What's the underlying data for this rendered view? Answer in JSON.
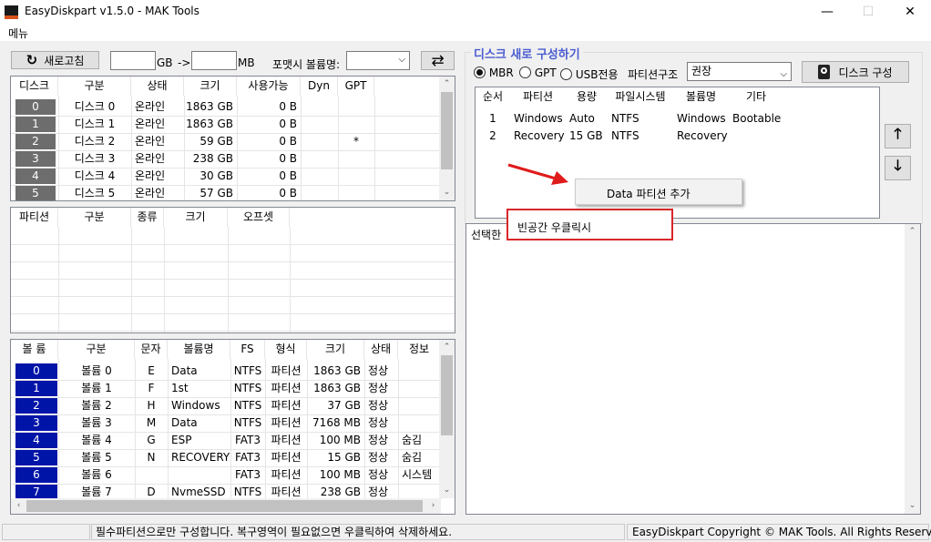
{
  "window": {
    "title": "EasyDiskpart v1.5.0 - MAK Tools",
    "menu": "메뉴",
    "minimize": "—",
    "maximize": "☐",
    "close": "✕"
  },
  "toolbar": {
    "refresh_label": "새로고침",
    "gb_unit": "GB",
    "arrow": "->",
    "mb_unit": "MB",
    "format_volume_label": "포맷시 볼륨명:",
    "swap_icon": "⇄"
  },
  "disks": {
    "headers": [
      "디스크",
      "구분",
      "상태",
      "크기",
      "사용가능",
      "Dyn",
      "GPT"
    ],
    "rows": [
      {
        "num": "0",
        "kind": "디스크 0",
        "status": "온라인",
        "size": "1863 GB",
        "free": "0 B",
        "dyn": "",
        "gpt": ""
      },
      {
        "num": "1",
        "kind": "디스크 1",
        "status": "온라인",
        "size": "1863 GB",
        "free": "0 B",
        "dyn": "",
        "gpt": ""
      },
      {
        "num": "2",
        "kind": "디스크 2",
        "status": "온라인",
        "size": "59 GB",
        "free": "0 B",
        "dyn": "",
        "gpt": "*"
      },
      {
        "num": "3",
        "kind": "디스크 3",
        "status": "온라인",
        "size": "238 GB",
        "free": "0 B",
        "dyn": "",
        "gpt": ""
      },
      {
        "num": "4",
        "kind": "디스크 4",
        "status": "온라인",
        "size": "30 GB",
        "free": "0 B",
        "dyn": "",
        "gpt": ""
      },
      {
        "num": "5",
        "kind": "디스크 5",
        "status": "온라인",
        "size": "57 GB",
        "free": "0 B",
        "dyn": "",
        "gpt": ""
      }
    ]
  },
  "partitions": {
    "headers": [
      "파티션",
      "구분",
      "종류",
      "크기",
      "오프셋"
    ]
  },
  "volumes": {
    "headers": [
      "볼 륨",
      "구분",
      "문자",
      "볼륨명",
      "FS",
      "형식",
      "크기",
      "상태",
      "정보"
    ],
    "rows": [
      {
        "num": "0",
        "kind": "볼륨 0",
        "letter": "E",
        "name": "Data",
        "fs": "NTFS",
        "type": "파티션",
        "size": "1863 GB",
        "status": "정상",
        "info": ""
      },
      {
        "num": "1",
        "kind": "볼륨 1",
        "letter": "F",
        "name": "1st",
        "fs": "NTFS",
        "type": "파티션",
        "size": "1863 GB",
        "status": "정상",
        "info": ""
      },
      {
        "num": "2",
        "kind": "볼륨 2",
        "letter": "H",
        "name": "Windows",
        "fs": "NTFS",
        "type": "파티션",
        "size": "37 GB",
        "status": "정상",
        "info": ""
      },
      {
        "num": "3",
        "kind": "볼륨 3",
        "letter": "M",
        "name": "Data",
        "fs": "NTFS",
        "type": "파티션",
        "size": "7168 MB",
        "status": "정상",
        "info": ""
      },
      {
        "num": "4",
        "kind": "볼륨 4",
        "letter": "G",
        "name": "ESP",
        "fs": "FAT3",
        "type": "파티션",
        "size": "100 MB",
        "status": "정상",
        "info": "숨김"
      },
      {
        "num": "5",
        "kind": "볼륨 5",
        "letter": "N",
        "name": "RECOVERY",
        "fs": "FAT3",
        "type": "파티션",
        "size": "15 GB",
        "status": "정상",
        "info": "숨김"
      },
      {
        "num": "6",
        "kind": "볼륨 6",
        "letter": "",
        "name": "",
        "fs": "FAT3",
        "type": "파티션",
        "size": "100 MB",
        "status": "정상",
        "info": "시스템"
      },
      {
        "num": "7",
        "kind": "볼륨 7",
        "letter": "D",
        "name": "NvmeSSD",
        "fs": "NTFS",
        "type": "파티션",
        "size": "238 GB",
        "status": "정상",
        "info": ""
      }
    ]
  },
  "rebuild": {
    "group_title": "디스크 새로 구성하기",
    "mbr": "MBR",
    "gpt": "GPT",
    "usb": "USB전용",
    "structure_label": "파티션구조",
    "structure_value": "권장",
    "build_button": "디스크 구성",
    "headers": [
      "순서",
      "파티션",
      "용량",
      "파일시스템",
      "볼륨명",
      "기타"
    ],
    "rows": [
      {
        "order": "1",
        "partition": "Windows",
        "size": "Auto",
        "fs": "NTFS",
        "volume": "Windows",
        "etc": "Bootable"
      },
      {
        "order": "2",
        "partition": "Recovery",
        "size": "15 GB",
        "fs": "NTFS",
        "volume": "Recovery",
        "etc": ""
      }
    ],
    "up_icon": "🡑",
    "down_icon": "🡓"
  },
  "context_menu": {
    "add_data_partition": "Data 파티션 추가"
  },
  "annotation": {
    "text": "빈공간 우클릭시"
  },
  "log": {
    "text": "선택한"
  },
  "status": {
    "message": "필수파티션으로만 구성합니다. 복구영역이 필요없으면 우클릭하여 삭제하세요.",
    "copyright": "EasyDiskpart Copyright © MAK Tools. All Rights Reserved."
  },
  "colors": {
    "disk_badge": "#6d6d6d",
    "volume_badge": "#0014a8",
    "group_title": "#4a5dd1",
    "annotation_border": "#d9262b",
    "arrow": "#e01b1b"
  }
}
